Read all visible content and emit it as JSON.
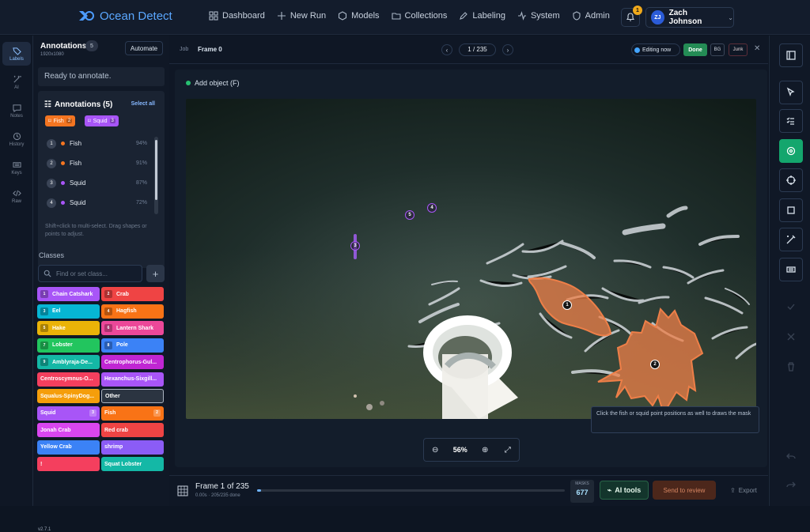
{
  "app": {
    "name": "Ocean Detect"
  },
  "nav": [
    {
      "label": "Dashboard",
      "icon": "grid-icon"
    },
    {
      "label": "New Run",
      "icon": "plus-icon"
    },
    {
      "label": "Models",
      "icon": "cube-icon"
    },
    {
      "label": "Collections",
      "icon": "folder-icon"
    },
    {
      "label": "Labeling",
      "icon": "pencil-icon"
    },
    {
      "label": "System",
      "icon": "pulse-icon"
    },
    {
      "label": "Admin",
      "icon": "shield-icon"
    }
  ],
  "notifications": {
    "count": "1"
  },
  "user": {
    "initials": "ZJ",
    "name": "Zach Johnson"
  },
  "leftRail": [
    {
      "label": "Labels",
      "icon": "tag-icon"
    },
    {
      "label": "AI",
      "icon": "magic-icon"
    },
    {
      "label": "Notes",
      "icon": "chat-icon"
    },
    {
      "label": "History",
      "icon": "history-icon"
    },
    {
      "label": "Keys",
      "icon": "keyboard-icon"
    },
    {
      "label": "Raw",
      "icon": "code-icon"
    }
  ],
  "panel": {
    "title": "Annotations",
    "count": "5",
    "resolution": "1920x1080",
    "automate": "Automate",
    "status": "Ready to annotate.",
    "listTitle": "Annotations (5)",
    "selectAll": "Select all",
    "pills": [
      {
        "label": "Fish",
        "count": "2",
        "color": "#f47521"
      },
      {
        "label": "Squid",
        "count": "3",
        "color": "#a855f7"
      }
    ],
    "rows": [
      {
        "num": "1",
        "label": "Fish",
        "pct": "94%",
        "color": "#f47521"
      },
      {
        "num": "2",
        "label": "Fish",
        "pct": "91%",
        "color": "#f47521"
      },
      {
        "num": "3",
        "label": "Squid",
        "pct": "87%",
        "color": "#a855f7"
      },
      {
        "num": "4",
        "label": "Squid",
        "pct": "72%",
        "color": "#a855f7"
      }
    ],
    "hint": "Shift+click to multi-select. Drag shapes or points to adjust.",
    "classesLabel": "Classes",
    "searchPlaceholder": "Find or set class..."
  },
  "classes": [
    {
      "label": "Chain Catshark",
      "key": "1",
      "color": "#a855f7"
    },
    {
      "label": "Crab",
      "key": "2",
      "color": "#ef4444"
    },
    {
      "label": "Eel",
      "key": "3",
      "color": "#06b6d4"
    },
    {
      "label": "Hagfish",
      "key": "4",
      "color": "#f97316"
    },
    {
      "label": "Hake",
      "key": "5",
      "color": "#eab308"
    },
    {
      "label": "Lantern Shark",
      "key": "6",
      "color": "#ec4899"
    },
    {
      "label": "Lobster",
      "key": "7",
      "color": "#22c55e"
    },
    {
      "label": "Pole",
      "key": "8",
      "color": "#3b82f6"
    },
    {
      "label": "Amblyraja-De...",
      "key": "9",
      "color": "#14b8a6"
    },
    {
      "label": "Centrophorus-Gul...",
      "key": "",
      "color": "#c026d3"
    },
    {
      "label": "Centroscymnus-O...",
      "key": "",
      "color": "#f43f5e"
    },
    {
      "label": "Hexanchus-Sixgill...",
      "key": "",
      "color": "#a855f7"
    },
    {
      "label": "Squalus-SpinyDog...",
      "key": "",
      "color": "#f59e0b"
    },
    {
      "label": "Other",
      "key": "",
      "color": "#4b5563"
    },
    {
      "label": "Squid",
      "key": "",
      "badge": "3",
      "color": "#a855f7"
    },
    {
      "label": "Fish",
      "key": "",
      "badge": "2",
      "color": "#f97316"
    },
    {
      "label": "Jonah Crab",
      "key": "",
      "color": "#d946ef"
    },
    {
      "label": "Red crab",
      "key": "",
      "color": "#ef4444"
    },
    {
      "label": "Yellow Crab",
      "key": "",
      "color": "#3b82f6"
    },
    {
      "label": "shrimp",
      "key": "",
      "color": "#8b5cf6"
    },
    {
      "label": "!",
      "key": "",
      "color": "#f43f5e"
    },
    {
      "label": "Squat Lobster",
      "key": "",
      "color": "#14b8a6"
    }
  ],
  "version": "v2.7.1",
  "job": {
    "label": "Job",
    "frame": "Frame 0",
    "page": "1 / 235",
    "editing": "Editing now",
    "done": "Done",
    "bg": "BG",
    "junk": "Junk"
  },
  "canvas": {
    "addObject": "Add object (F)",
    "tooltip": "Click the fish or squid point positions as well to draws the mask",
    "zoom": "56%",
    "points": [
      {
        "num": "1",
        "color": "#111111"
      },
      {
        "num": "2",
        "color": "#111111"
      },
      {
        "num": "3",
        "color": "#a855f7"
      },
      {
        "num": "4",
        "color": "#a855f7"
      },
      {
        "num": "5",
        "color": "#a855f7"
      }
    ]
  },
  "bottom": {
    "frame": "Frame 1 of 235",
    "timing": "0.00s · 205/235 done",
    "progress": 0.013,
    "masksLabel": "MASKS",
    "masks": "677",
    "aiTools": "AI tools",
    "review": "Send to review",
    "export": "Export"
  },
  "rightRail": [
    {
      "name": "layout-icon"
    },
    {
      "name": "cursor-icon"
    },
    {
      "name": "checklist-icon"
    },
    {
      "name": "target-icon"
    },
    {
      "name": "crosshair-icon"
    },
    {
      "name": "square-icon"
    },
    {
      "name": "wand-icon"
    },
    {
      "name": "keyboard-icon"
    },
    {
      "name": "check-icon"
    },
    {
      "name": "close-icon"
    },
    {
      "name": "trash-icon"
    },
    {
      "name": "undo-icon"
    },
    {
      "name": "redo-icon"
    }
  ]
}
